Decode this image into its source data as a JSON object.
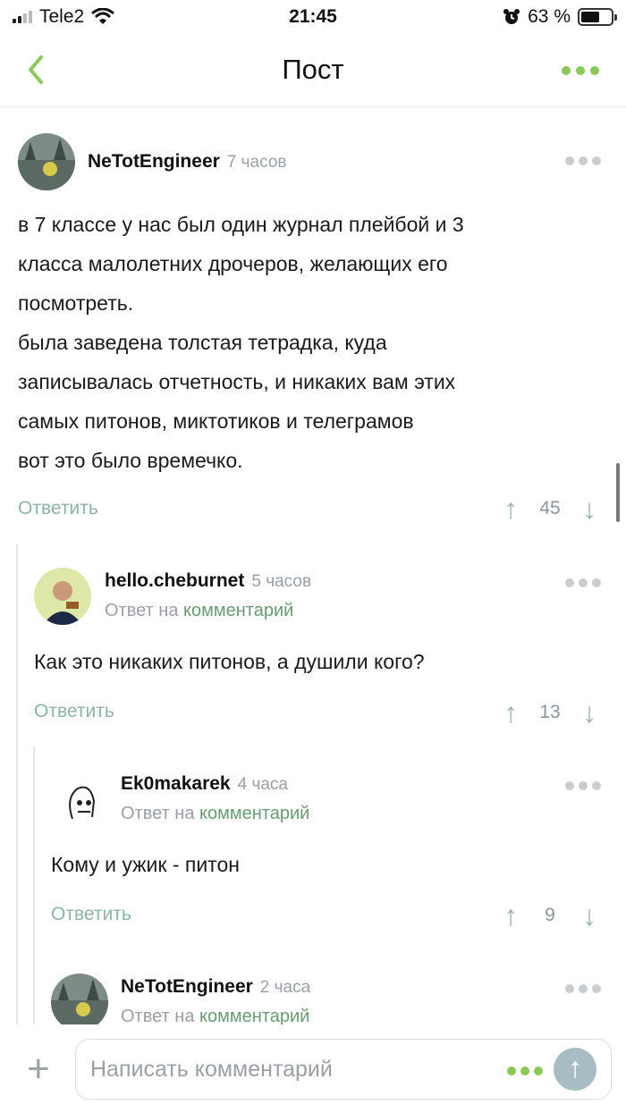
{
  "status_bar": {
    "carrier": "Tele2",
    "time": "21:45",
    "battery": "63 %",
    "battery_level": 0.63
  },
  "nav": {
    "title": "Пост",
    "back_icon": "chevron-left-icon",
    "more_icon": "more-dots-icon"
  },
  "comments": [
    {
      "author": "NeTotEngineer",
      "time": "7 часов",
      "text": "в 7 классе у нас был один журнал плейбой и 3\nкласса малолетних дрочеров, желающих его\nпосмотреть.\nбыла заведена толстая тетрадка, куда\nзаписывалась отчетность, и никаких вам этих\nсамых питонов, миктотиков и телеграмов\nвот это было времечко.",
      "reply_label": "Ответить",
      "votes": "45"
    },
    {
      "author": "hello.cheburnet",
      "time": "5 часов",
      "reply_prefix": "Ответ на",
      "reply_link": "комментарий",
      "text": "Как это никаких питонов, а душили кого?",
      "reply_label": "Ответить",
      "votes": "13"
    },
    {
      "author": "Ek0makarek",
      "time": "4 часа",
      "reply_prefix": "Ответ на",
      "reply_link": "комментарий",
      "text": "Кому и ужик - питон",
      "reply_label": "Ответить",
      "votes": "9"
    },
    {
      "author": "NeTotEngineer",
      "time": "2 часа",
      "reply_prefix": "Ответ на",
      "reply_link": "комментарий"
    }
  ],
  "bottom": {
    "placeholder": "Написать комментарий"
  },
  "colors": {
    "accent": "#8ac858",
    "link": "#6a9a74",
    "muted": "#9aa0a6"
  }
}
